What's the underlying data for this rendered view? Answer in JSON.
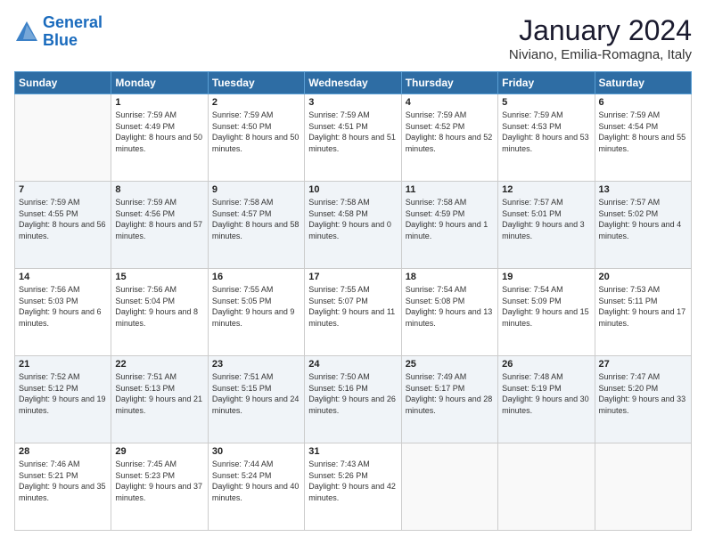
{
  "logo": {
    "line1": "General",
    "line2": "Blue"
  },
  "header": {
    "month": "January 2024",
    "location": "Niviano, Emilia-Romagna, Italy"
  },
  "weekdays": [
    "Sunday",
    "Monday",
    "Tuesday",
    "Wednesday",
    "Thursday",
    "Friday",
    "Saturday"
  ],
  "weeks": [
    [
      {
        "day": "",
        "sunrise": "",
        "sunset": "",
        "daylight": ""
      },
      {
        "day": "1",
        "sunrise": "Sunrise: 7:59 AM",
        "sunset": "Sunset: 4:49 PM",
        "daylight": "Daylight: 8 hours and 50 minutes."
      },
      {
        "day": "2",
        "sunrise": "Sunrise: 7:59 AM",
        "sunset": "Sunset: 4:50 PM",
        "daylight": "Daylight: 8 hours and 50 minutes."
      },
      {
        "day": "3",
        "sunrise": "Sunrise: 7:59 AM",
        "sunset": "Sunset: 4:51 PM",
        "daylight": "Daylight: 8 hours and 51 minutes."
      },
      {
        "day": "4",
        "sunrise": "Sunrise: 7:59 AM",
        "sunset": "Sunset: 4:52 PM",
        "daylight": "Daylight: 8 hours and 52 minutes."
      },
      {
        "day": "5",
        "sunrise": "Sunrise: 7:59 AM",
        "sunset": "Sunset: 4:53 PM",
        "daylight": "Daylight: 8 hours and 53 minutes."
      },
      {
        "day": "6",
        "sunrise": "Sunrise: 7:59 AM",
        "sunset": "Sunset: 4:54 PM",
        "daylight": "Daylight: 8 hours and 55 minutes."
      }
    ],
    [
      {
        "day": "7",
        "sunrise": "Sunrise: 7:59 AM",
        "sunset": "Sunset: 4:55 PM",
        "daylight": "Daylight: 8 hours and 56 minutes."
      },
      {
        "day": "8",
        "sunrise": "Sunrise: 7:59 AM",
        "sunset": "Sunset: 4:56 PM",
        "daylight": "Daylight: 8 hours and 57 minutes."
      },
      {
        "day": "9",
        "sunrise": "Sunrise: 7:58 AM",
        "sunset": "Sunset: 4:57 PM",
        "daylight": "Daylight: 8 hours and 58 minutes."
      },
      {
        "day": "10",
        "sunrise": "Sunrise: 7:58 AM",
        "sunset": "Sunset: 4:58 PM",
        "daylight": "Daylight: 9 hours and 0 minutes."
      },
      {
        "day": "11",
        "sunrise": "Sunrise: 7:58 AM",
        "sunset": "Sunset: 4:59 PM",
        "daylight": "Daylight: 9 hours and 1 minute."
      },
      {
        "day": "12",
        "sunrise": "Sunrise: 7:57 AM",
        "sunset": "Sunset: 5:01 PM",
        "daylight": "Daylight: 9 hours and 3 minutes."
      },
      {
        "day": "13",
        "sunrise": "Sunrise: 7:57 AM",
        "sunset": "Sunset: 5:02 PM",
        "daylight": "Daylight: 9 hours and 4 minutes."
      }
    ],
    [
      {
        "day": "14",
        "sunrise": "Sunrise: 7:56 AM",
        "sunset": "Sunset: 5:03 PM",
        "daylight": "Daylight: 9 hours and 6 minutes."
      },
      {
        "day": "15",
        "sunrise": "Sunrise: 7:56 AM",
        "sunset": "Sunset: 5:04 PM",
        "daylight": "Daylight: 9 hours and 8 minutes."
      },
      {
        "day": "16",
        "sunrise": "Sunrise: 7:55 AM",
        "sunset": "Sunset: 5:05 PM",
        "daylight": "Daylight: 9 hours and 9 minutes."
      },
      {
        "day": "17",
        "sunrise": "Sunrise: 7:55 AM",
        "sunset": "Sunset: 5:07 PM",
        "daylight": "Daylight: 9 hours and 11 minutes."
      },
      {
        "day": "18",
        "sunrise": "Sunrise: 7:54 AM",
        "sunset": "Sunset: 5:08 PM",
        "daylight": "Daylight: 9 hours and 13 minutes."
      },
      {
        "day": "19",
        "sunrise": "Sunrise: 7:54 AM",
        "sunset": "Sunset: 5:09 PM",
        "daylight": "Daylight: 9 hours and 15 minutes."
      },
      {
        "day": "20",
        "sunrise": "Sunrise: 7:53 AM",
        "sunset": "Sunset: 5:11 PM",
        "daylight": "Daylight: 9 hours and 17 minutes."
      }
    ],
    [
      {
        "day": "21",
        "sunrise": "Sunrise: 7:52 AM",
        "sunset": "Sunset: 5:12 PM",
        "daylight": "Daylight: 9 hours and 19 minutes."
      },
      {
        "day": "22",
        "sunrise": "Sunrise: 7:51 AM",
        "sunset": "Sunset: 5:13 PM",
        "daylight": "Daylight: 9 hours and 21 minutes."
      },
      {
        "day": "23",
        "sunrise": "Sunrise: 7:51 AM",
        "sunset": "Sunset: 5:15 PM",
        "daylight": "Daylight: 9 hours and 24 minutes."
      },
      {
        "day": "24",
        "sunrise": "Sunrise: 7:50 AM",
        "sunset": "Sunset: 5:16 PM",
        "daylight": "Daylight: 9 hours and 26 minutes."
      },
      {
        "day": "25",
        "sunrise": "Sunrise: 7:49 AM",
        "sunset": "Sunset: 5:17 PM",
        "daylight": "Daylight: 9 hours and 28 minutes."
      },
      {
        "day": "26",
        "sunrise": "Sunrise: 7:48 AM",
        "sunset": "Sunset: 5:19 PM",
        "daylight": "Daylight: 9 hours and 30 minutes."
      },
      {
        "day": "27",
        "sunrise": "Sunrise: 7:47 AM",
        "sunset": "Sunset: 5:20 PM",
        "daylight": "Daylight: 9 hours and 33 minutes."
      }
    ],
    [
      {
        "day": "28",
        "sunrise": "Sunrise: 7:46 AM",
        "sunset": "Sunset: 5:21 PM",
        "daylight": "Daylight: 9 hours and 35 minutes."
      },
      {
        "day": "29",
        "sunrise": "Sunrise: 7:45 AM",
        "sunset": "Sunset: 5:23 PM",
        "daylight": "Daylight: 9 hours and 37 minutes."
      },
      {
        "day": "30",
        "sunrise": "Sunrise: 7:44 AM",
        "sunset": "Sunset: 5:24 PM",
        "daylight": "Daylight: 9 hours and 40 minutes."
      },
      {
        "day": "31",
        "sunrise": "Sunrise: 7:43 AM",
        "sunset": "Sunset: 5:26 PM",
        "daylight": "Daylight: 9 hours and 42 minutes."
      },
      {
        "day": "",
        "sunrise": "",
        "sunset": "",
        "daylight": ""
      },
      {
        "day": "",
        "sunrise": "",
        "sunset": "",
        "daylight": ""
      },
      {
        "day": "",
        "sunrise": "",
        "sunset": "",
        "daylight": ""
      }
    ]
  ]
}
